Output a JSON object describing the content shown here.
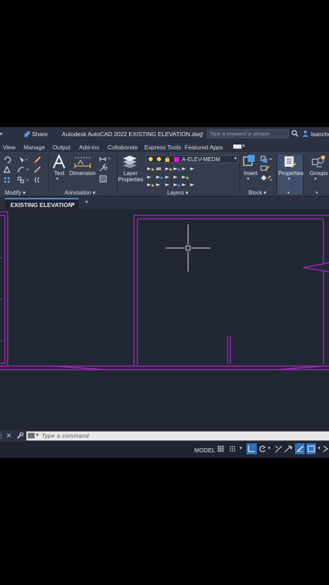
{
  "titlebar": {
    "share_label": "Share",
    "app_title": "Autodesk AutoCAD 2022   EXISTING ELEVATION.dwg",
    "search_placeholder": "Type a keyword or phrase",
    "user": "lsanche"
  },
  "menu_tabs": [
    "View",
    "Manage",
    "Output",
    "Add-ins",
    "Collaborate",
    "Express Tools",
    "Featured Apps"
  ],
  "ribbon": {
    "modify_label": "Modify ▾",
    "annotation_label": "Annotation ▾",
    "text_label": "Text",
    "dimension_label": "Dimension",
    "layer_properties_line1": "Layer",
    "layer_properties_line2": "Properties",
    "current_layer": "A-ELEV-MEDM",
    "current_layer_color": "#e51bd4",
    "layers_label": "Layers ▾",
    "insert_label": "Insert",
    "block_label": "Block ▾",
    "properties_label": "Properties",
    "groups_label": "Groups"
  },
  "file_tab": {
    "label": "EXISTING ELEVATION*"
  },
  "command": {
    "placeholder": "Type a command"
  },
  "status": {
    "model_label": "MODEL"
  },
  "colors": {
    "drawing_lines": "#b22bd0",
    "accent": "#4b8fe0",
    "canvas_bg": "#212633"
  }
}
